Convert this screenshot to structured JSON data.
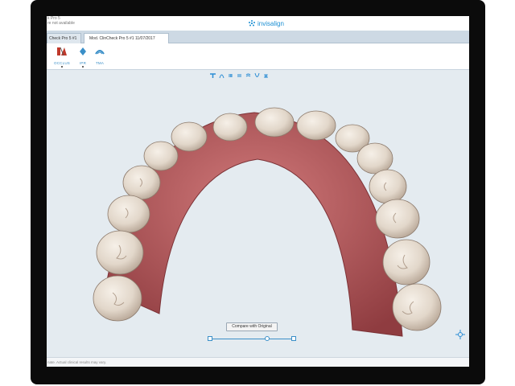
{
  "header": {
    "patient_line1": "k Pro 5",
    "patient_line2": "re not available",
    "brand": "invisalign"
  },
  "tabs": [
    {
      "label": "Check Pro 5 #1"
    },
    {
      "label": "Mod. ClinCheck Pro 5 #1 11/07/2017"
    }
  ],
  "toolbar": {
    "tools": [
      {
        "label": "OCCLUS",
        "icon": "occlusion-icon"
      },
      {
        "label": "IPR",
        "icon": "ipr-diamond-icon"
      },
      {
        "label": "TMA",
        "icon": "tma-icon"
      }
    ]
  },
  "view_icons": [
    "top-view-icon",
    "front-view-icon",
    "left-view-icon",
    "right-view-icon",
    "upper-jaw-icon",
    "lower-jaw-icon",
    "occlusal-view-icon"
  ],
  "compare": {
    "label": "Compare with Original"
  },
  "slider": {
    "position": 0.68
  },
  "footer": {
    "text": "nate. Actual clinical results may vary."
  },
  "colors": {
    "accent": "#2a8cd4",
    "background": "#e4ebf0",
    "gum": "#b8585a",
    "tooth": "#e6ddd2"
  }
}
